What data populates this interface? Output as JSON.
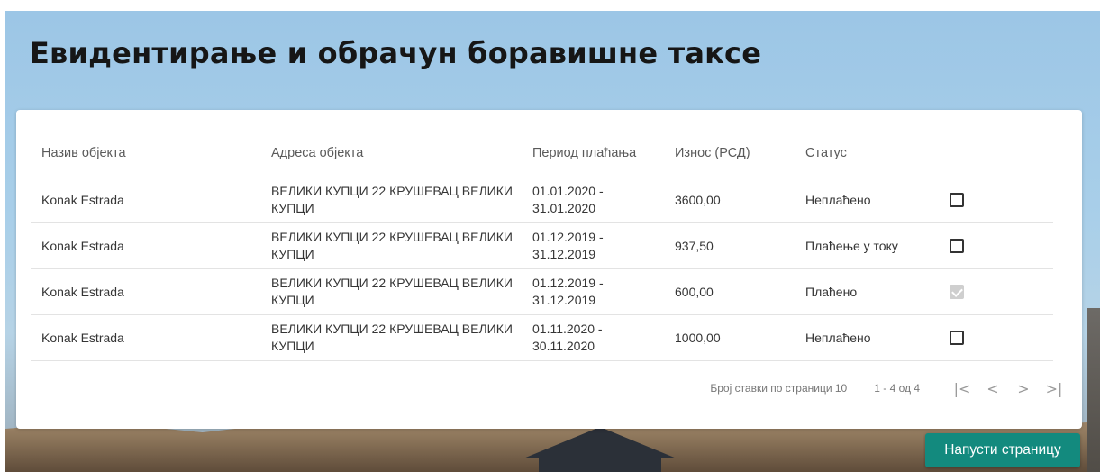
{
  "page": {
    "title": "Евидентирање и обрачун боравишне таксе"
  },
  "table": {
    "headers": {
      "name": "Назив објекта",
      "address": "Адреса објекта",
      "period": "Период плаћања",
      "amount": "Износ (РСД)",
      "status": "Статус"
    },
    "rows": [
      {
        "name": "Konak Estrada",
        "address": "ВЕЛИКИ КУПЦИ 22 КРУШЕВАЦ ВЕЛИКИ КУПЦИ",
        "period": "01.01.2020 - 31.01.2020",
        "amount": "3600,00",
        "status": "Неплаћено",
        "checked": false
      },
      {
        "name": "Konak Estrada",
        "address": "ВЕЛИКИ КУПЦИ 22 КРУШЕВАЦ ВЕЛИКИ КУПЦИ",
        "period": "01.12.2019 - 31.12.2019",
        "amount": "937,50",
        "status": "Плаћење у току",
        "checked": false
      },
      {
        "name": "Konak Estrada",
        "address": "ВЕЛИКИ КУПЦИ 22 КРУШЕВАЦ ВЕЛИКИ КУПЦИ",
        "period": "01.12.2019 - 31.12.2019",
        "amount": "600,00",
        "status": "Плаћено",
        "checked": true
      },
      {
        "name": "Konak Estrada",
        "address": "ВЕЛИКИ КУПЦИ 22 КРУШЕВАЦ ВЕЛИКИ КУПЦИ",
        "period": "01.11.2020 - 30.11.2020",
        "amount": "1000,00",
        "status": "Неплаћено",
        "checked": false
      }
    ]
  },
  "paginator": {
    "items_per_page_label": "Број ставки по страници",
    "items_per_page_value": "10",
    "range_label": "1 - 4 од 4",
    "first_icon": "first-page-icon",
    "prev_icon": "chevron-left-icon",
    "next_icon": "chevron-right-icon",
    "last_icon": "last-page-icon"
  },
  "actions": {
    "leave_label": "Напусти страницу"
  },
  "colors": {
    "accent": "#138a7e",
    "sky": "#9cc6e6"
  }
}
